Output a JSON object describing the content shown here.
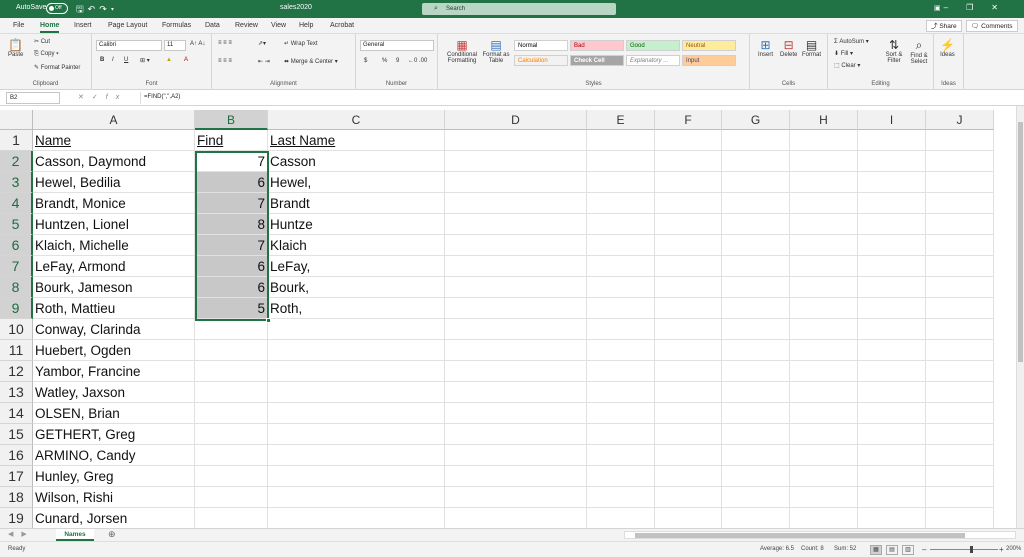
{
  "titlebar": {
    "autosave_label": "AutoSave",
    "autosave_state": "Off",
    "doc_title": "sales2020",
    "search_placeholder": "Search",
    "qat_icons": [
      "save-icon",
      "undo-icon",
      "redo-icon",
      "customize-icon"
    ]
  },
  "tabs": [
    "File",
    "Home",
    "Insert",
    "Page Layout",
    "Formulas",
    "Data",
    "Review",
    "View",
    "Help",
    "Acrobat"
  ],
  "active_tab": "Home",
  "share_label": "Share",
  "comments_label": "Comments",
  "ribbon": {
    "clipboard": {
      "paste": "Paste",
      "cut": "Cut",
      "copy": "Copy",
      "format_painter": "Format Painter",
      "label": "Clipboard"
    },
    "font": {
      "name": "Calibri",
      "size": "11",
      "label": "Font",
      "bold": "B",
      "italic": "I",
      "underline": "U"
    },
    "alignment": {
      "wrap": "Wrap Text",
      "merge": "Merge & Center",
      "label": "Alignment"
    },
    "number": {
      "format": "General",
      "currency": "$",
      "percent": "%",
      "comma": "9",
      "label": "Number"
    },
    "styles": {
      "conditional": "Conditional Formatting",
      "format_table": "Format as Table",
      "cells": [
        {
          "text": "Normal",
          "bg": "#ffffff",
          "color": "#000000"
        },
        {
          "text": "Bad",
          "bg": "#ffc7ce",
          "color": "#9c0006"
        },
        {
          "text": "Good",
          "bg": "#c6efce",
          "color": "#006100"
        },
        {
          "text": "Neutral",
          "bg": "#ffeb9c",
          "color": "#9c5700"
        },
        {
          "text": "Calculation",
          "bg": "#f2f2f2",
          "color": "#fa7d00"
        },
        {
          "text": "Check Cell",
          "bg": "#a5a5a5",
          "color": "#ffffff"
        },
        {
          "text": "Explanatory ...",
          "bg": "#ffffff",
          "color": "#7f7f7f"
        },
        {
          "text": "Input",
          "bg": "#ffcc99",
          "color": "#3f3f76"
        }
      ],
      "label": "Styles"
    },
    "cells": {
      "insert": "Insert",
      "delete": "Delete",
      "format": "Format",
      "label": "Cells"
    },
    "editing": {
      "autosum": "AutoSum",
      "fill": "Fill",
      "clear": "Clear",
      "sort": "Sort & Filter",
      "find": "Find & Select",
      "label": "Editing"
    },
    "ideas": {
      "ideas": "Ideas",
      "label": "Ideas"
    }
  },
  "formula_bar": {
    "name_box": "B2",
    "formula": "=FIND(\",\",A2)",
    "fx": "fx"
  },
  "columns": [
    "A",
    "B",
    "C",
    "D",
    "E",
    "F",
    "G",
    "H",
    "I",
    "J"
  ],
  "rows": [
    {
      "n": "1",
      "a": "Name",
      "b": "Find",
      "c": "Last Name"
    },
    {
      "n": "2",
      "a": "Casson, Daymond",
      "b": "7",
      "c": "Casson"
    },
    {
      "n": "3",
      "a": "Hewel, Bedilia",
      "b": "6",
      "c": "Hewel,"
    },
    {
      "n": "4",
      "a": "Brandt, Monice",
      "b": "7",
      "c": "Brandt"
    },
    {
      "n": "5",
      "a": "Huntzen, Lionel",
      "b": "8",
      "c": "Huntze"
    },
    {
      "n": "6",
      "a": "Klaich, Michelle",
      "b": "7",
      "c": "Klaich"
    },
    {
      "n": "7",
      "a": "LeFay, Armond",
      "b": "6",
      "c": "LeFay,"
    },
    {
      "n": "8",
      "a": "Bourk, Jameson",
      "b": "6",
      "c": "Bourk,"
    },
    {
      "n": "9",
      "a": "Roth, Mattieu",
      "b": "5",
      "c": "Roth,"
    },
    {
      "n": "10",
      "a": "Conway, Clarinda",
      "b": "",
      "c": ""
    },
    {
      "n": "11",
      "a": "Huebert, Ogden",
      "b": "",
      "c": ""
    },
    {
      "n": "12",
      "a": "Yambor, Francine",
      "b": "",
      "c": ""
    },
    {
      "n": "13",
      "a": "Watley, Jaxson",
      "b": "",
      "c": ""
    },
    {
      "n": "14",
      "a": "OLSEN, Brian",
      "b": "",
      "c": ""
    },
    {
      "n": "15",
      "a": "GETHERT, Greg",
      "b": "",
      "c": ""
    },
    {
      "n": "16",
      "a": "ARMINO, Candy",
      "b": "",
      "c": ""
    },
    {
      "n": "17",
      "a": "Hunley, Greg",
      "b": "",
      "c": ""
    },
    {
      "n": "18",
      "a": "Wilson, Rishi",
      "b": "",
      "c": ""
    },
    {
      "n": "19",
      "a": "Cunard, Jorsen",
      "b": "",
      "c": ""
    }
  ],
  "sheet_tab": "Names",
  "status": {
    "ready": "Ready",
    "average": "Average: 6.5",
    "count": "Count: 8",
    "sum": "Sum: 52",
    "zoom": "200%"
  }
}
